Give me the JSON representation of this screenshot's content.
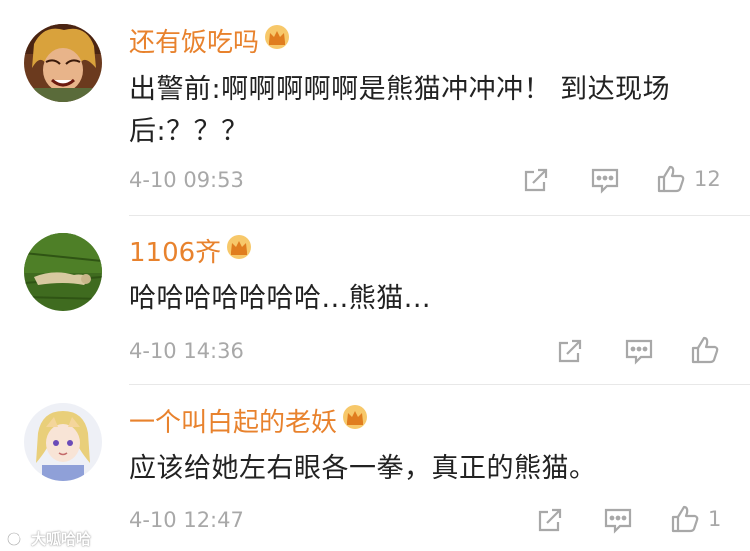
{
  "comments": [
    {
      "username": "还有饭吃吗",
      "text": "出警前:啊啊啊啊啊是熊猫冲冲冲！ 到达现场后:？？？",
      "time": "4-10 09:53",
      "likes": "12",
      "avatar": "anime-character-avatar"
    },
    {
      "username": "1106齐",
      "text": "哈哈哈哈哈哈哈...熊猫...",
      "time": "4-10 14:36",
      "likes": "",
      "avatar": "grass-field-avatar"
    },
    {
      "username": "一个叫白起的老妖",
      "text": "应该给她左右眼各一拳，真正的熊猫。",
      "time": "4-10 12:47",
      "likes": "1",
      "avatar": "anime-girl-avatar"
    }
  ],
  "watermark": {
    "text": "大呱哈哈"
  },
  "colors": {
    "username": "#e8822d",
    "crown": "#f0a93b",
    "text": "#222222",
    "meta": "#a8a8a8",
    "divider": "#e8e8e8"
  },
  "icons": [
    "crown-icon",
    "share-icon",
    "comment-icon",
    "like-icon"
  ]
}
